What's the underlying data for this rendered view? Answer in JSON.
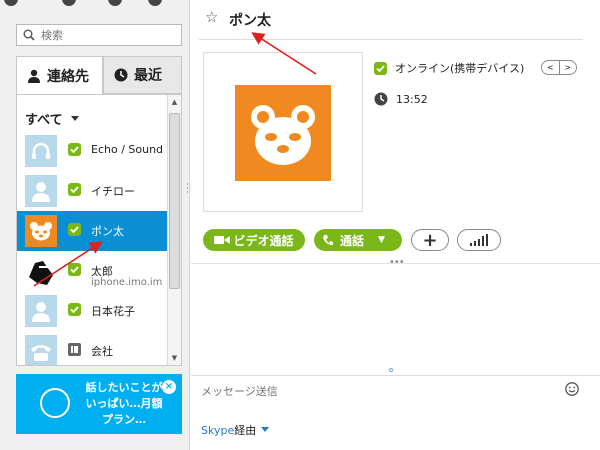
{
  "search": {
    "placeholder": "検索"
  },
  "tabs": [
    {
      "label": "連絡先"
    },
    {
      "label": "最近"
    }
  ],
  "filter": {
    "label": "すべて"
  },
  "contacts": [
    {
      "name": "Echo / Sound Test Service",
      "status": "online"
    },
    {
      "name": "イチロー",
      "status": "online"
    },
    {
      "name": "ポン太",
      "status": "online",
      "selected": true
    },
    {
      "name": "太郎",
      "sub": "iphone.imo.im",
      "status": "online"
    },
    {
      "name": "日本花子",
      "status": "online"
    },
    {
      "name": "会社",
      "status": "landline"
    }
  ],
  "promo": {
    "text": "話したいことがいっぱい…月額プラン…"
  },
  "conversation": {
    "title": "ポン太",
    "status_text": "オンライン(携帯デバイス)",
    "local_time": "13:52",
    "buttons": {
      "video": "ビデオ通話",
      "call": "通話"
    }
  },
  "message": {
    "placeholder": "メッセージ送信"
  },
  "via": {
    "brand": "Skype",
    "suffix": "経由"
  },
  "colors": {
    "skype_blue": "#00aff0",
    "green": "#7bb718",
    "selection": "#0a8fd4",
    "annotation": "#e02020"
  }
}
